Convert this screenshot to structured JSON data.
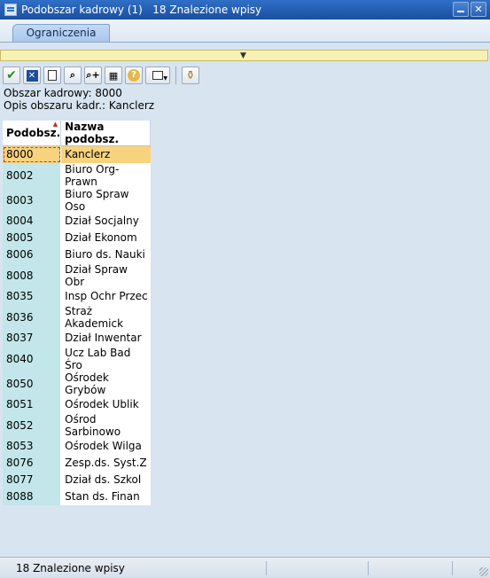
{
  "window": {
    "title": "Podobszar kadrowy (1)   18 Znalezione wpisy",
    "minimize_icon": "minimize-icon",
    "close_icon": "close-icon",
    "close_glyph": "✕"
  },
  "tabs": [
    {
      "label": "Ograniczenia"
    }
  ],
  "toolbar": {
    "buttons": [
      {
        "icon": "checkmark-icon"
      },
      {
        "icon": "cancel-icon"
      },
      {
        "icon": "new-document-icon"
      },
      {
        "icon": "find-icon"
      },
      {
        "icon": "find-next-icon"
      },
      {
        "icon": "select-icon"
      },
      {
        "icon": "help-icon"
      },
      {
        "icon": "print-icon"
      },
      {
        "icon": "filter-icon"
      }
    ]
  },
  "info": {
    "line1": "Obszar kadrowy: 8000",
    "line2": "Opis obszaru kadr.: Kanclerz"
  },
  "table": {
    "columns": [
      "Podobsz.",
      "Nazwa podobsz."
    ],
    "rows": [
      [
        "8000",
        "Kanclerz"
      ],
      [
        "8002",
        "Biuro Org-Prawn"
      ],
      [
        "8003",
        "Biuro Spraw Oso"
      ],
      [
        "8004",
        "Dział Socjalny"
      ],
      [
        "8005",
        "Dział Ekonom"
      ],
      [
        "8006",
        "Biuro ds. Nauki"
      ],
      [
        "8008",
        "Dział Spraw Obr"
      ],
      [
        "8035",
        "Insp Ochr Przec"
      ],
      [
        "8036",
        "Straż Akademick"
      ],
      [
        "8037",
        "Dział Inwentar"
      ],
      [
        "8040",
        "Ucz Lab Bad Śro"
      ],
      [
        "8050",
        "Ośrodek Grybów"
      ],
      [
        "8051",
        "Ośrodek Ublik"
      ],
      [
        "8052",
        "Ośrod Sarbinowo"
      ],
      [
        "8053",
        "Ośrodek Wilga"
      ],
      [
        "8076",
        "Zesp.ds. Syst.Z"
      ],
      [
        "8077",
        "Dział ds. Szkol"
      ],
      [
        "8088",
        "Stan ds. Finan"
      ]
    ],
    "selected_row": 0
  },
  "status": {
    "text": "18 Znalezione wpisy"
  }
}
